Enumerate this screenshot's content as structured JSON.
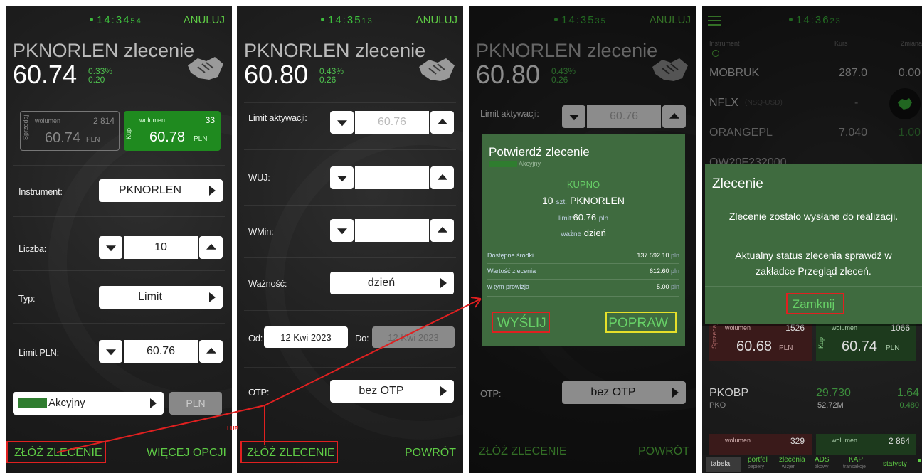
{
  "colors": {
    "accent_green": "#5ecb45",
    "buy_green": "#1f8a1f",
    "highlight_red": "#e02020",
    "highlight_yellow": "#e6e02a",
    "dialog_green": "#3f6b3f"
  },
  "connector_label": "LUB",
  "screen1": {
    "time_main": "14:34",
    "time_sec": "54",
    "cancel": "ANULUJ",
    "title": "PKNORLEN zlecenie",
    "price": "60.74",
    "chg_pct": "0.33%",
    "chg_abs": "0.20",
    "sell": {
      "side": "Sprzedaj",
      "vol_label": "wolumen",
      "vol": "2 814",
      "price": "60.74",
      "unit": "PLN"
    },
    "buy": {
      "side": "Kup",
      "vol_label": "wolumen",
      "vol": "33",
      "price": "60.78",
      "unit": "PLN"
    },
    "instrument_label": "Instrument:",
    "instrument_value": "PKNORLEN",
    "qty_label": "Liczba:",
    "qty_value": "10",
    "type_label": "Typ:",
    "type_value": "Limit",
    "limit_label": "Limit PLN:",
    "limit_value": "60.76",
    "account_value": "Akcyjny",
    "currency": "PLN",
    "submit": "ZŁÓŻ ZLECENIE",
    "more": "WIĘCEJ OPCJI"
  },
  "screen2": {
    "time_main": "14:35",
    "time_sec": "13",
    "cancel": "ANULUJ",
    "title": "PKNORLEN zlecenie",
    "price": "60.80",
    "chg_pct": "0.43%",
    "chg_abs": "0.26",
    "activation_label": "Limit aktywacji:",
    "activation_value": "60.76",
    "wuj_label": "WUJ:",
    "wmin_label": "WMin:",
    "validity_label": "Ważność:",
    "validity_value": "dzień",
    "from_label": "Od:",
    "from_value": "12 Kwi 2023",
    "to_label": "Do:",
    "to_value": "12 Kwi 2023",
    "otp_label": "OTP:",
    "otp_value": "bez OTP",
    "submit": "ZŁÓŻ ZLECENIE",
    "back": "POWRÓT"
  },
  "screen3": {
    "time_main": "14:35",
    "time_sec": "35",
    "cancel": "ANULUJ",
    "title": "PKNORLEN zlecenie",
    "price": "60.80",
    "chg_pct": "0.43%",
    "chg_abs": "0.26",
    "activation_label": "Limit aktywacji:",
    "activation_value": "60.76",
    "dialog": {
      "title": "Potwierdź zlecenie",
      "account": "Akcyjny",
      "side": "KUPNO",
      "qty": "10",
      "qty_unit": "szt.",
      "instrument": "PKNORLEN",
      "limit_label": "limit:",
      "limit_value": "60.76",
      "limit_unit": "pln",
      "valid_label": "ważne",
      "valid_value": "dzień",
      "rows": [
        {
          "label": "Dostępne środki",
          "value": "137 592.10",
          "unit": "pln"
        },
        {
          "label": "Wartość zlecenia",
          "value": "612.60",
          "unit": "pln"
        },
        {
          "label": "w tym prowizja",
          "value": "5.00",
          "unit": "pln"
        }
      ],
      "send": "WYŚLIJ",
      "fix": "POPRAW"
    },
    "otp_label": "OTP:",
    "otp_value": "bez OTP",
    "submit": "ZŁÓŻ ZLECENIE",
    "back": "POWRÓT"
  },
  "screen4": {
    "time_main": "14:36",
    "time_sec": "23",
    "col_instrument": "Instrument",
    "col_rate": "Kurs",
    "col_change": "Zmiana",
    "rows": [
      {
        "name": "MOBRUK",
        "sub": "",
        "rate": "287.0",
        "change": "0.00"
      },
      {
        "name": "NFLX",
        "sub": "(NSQ-USD)",
        "rate": "-",
        "change": ""
      },
      {
        "name": "ORANGEPL",
        "sub": "",
        "rate": "7.040",
        "change": "1.00"
      },
      {
        "name": "OW20F232000",
        "sub": "",
        "rate": "",
        "change": ""
      }
    ],
    "dialog": {
      "title": "Zlecenie",
      "msg1": "Zlecenie zostało wysłane do realizacji.",
      "msg2": "Aktualny status zlecenia sprawdź w zakładce Przegląd zleceń.",
      "close": "Zamknij"
    },
    "sell": {
      "side": "Sprzedaj",
      "vol_label": "wolumen",
      "vol": "1526",
      "price": "60.68",
      "unit": "PLN"
    },
    "buy": {
      "side": "Kup",
      "vol_label": "wolumen",
      "vol": "1066",
      "price": "60.74",
      "unit": "PLN"
    },
    "pkobp": {
      "name": "PKOBP",
      "sub": "PKO",
      "rate": "29.730",
      "volume": "52.72M",
      "chg_pct": "1.64",
      "chg_abs": "0.480"
    },
    "sell2": {
      "vol_label": "wolumen",
      "vol": "329"
    },
    "buy2": {
      "vol_label": "wolumen",
      "vol": "2 864"
    },
    "tabs": [
      {
        "label": "tabela",
        "sub": ""
      },
      {
        "label": "portfel",
        "sub": "papiery"
      },
      {
        "label": "zlecenia",
        "sub": "wizjer"
      },
      {
        "label": "ADS",
        "sub": "tikowy"
      },
      {
        "label": "KAP",
        "sub": "transakcje"
      },
      {
        "label": "statysty",
        "sub": ""
      }
    ]
  }
}
